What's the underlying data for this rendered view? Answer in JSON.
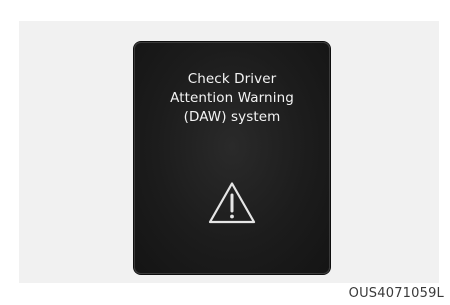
{
  "display": {
    "message_lines": [
      "Check Driver",
      "Attention Warning",
      "(DAW) system"
    ],
    "icon": "warning-triangle-icon",
    "background_color": "#1c1c1c",
    "text_color": "#f4f4f4"
  },
  "figure_code": "OUS4071059L"
}
